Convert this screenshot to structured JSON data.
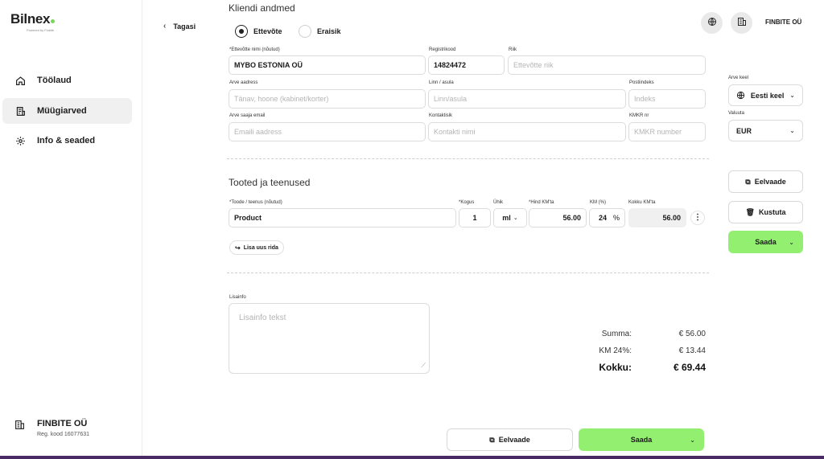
{
  "brand": {
    "logo": "Bilnex",
    "tagline": "Powered by Finbite"
  },
  "sidebar": {
    "items": [
      {
        "label": "Töölaud",
        "icon": "home-icon"
      },
      {
        "label": "Müügiarved",
        "icon": "invoice-icon",
        "active": true
      },
      {
        "label": "Info & seaded",
        "icon": "gear-icon"
      }
    ],
    "company": {
      "name": "FINBITE OÜ",
      "reg": "Reg. kood 16077631",
      "icon": "building-icon"
    }
  },
  "nav": {
    "back_label": "Tagasi"
  },
  "header": {
    "company_name": "FINBITE OÜ",
    "icons": [
      "globe-icon",
      "building-icon"
    ]
  },
  "client": {
    "title": "Kliendi andmed",
    "type_options": [
      "Ettevõte",
      "Eraisik"
    ],
    "type_selected": "Ettevõte",
    "fields": {
      "company_name": {
        "label": "*Ettevõtte nimi (nõutud)",
        "value": "MYBO ESTONIA OÜ"
      },
      "reg_code": {
        "label": "Registrikood",
        "value": "14824472"
      },
      "country": {
        "label": "Riik",
        "placeholder": "Ettevõtte riik"
      },
      "address": {
        "label": "Arve aadress",
        "placeholder": "Tänav, hoone (kabinet/korter)"
      },
      "city": {
        "label": "Linn / asula",
        "placeholder": "Linn/asula"
      },
      "postal": {
        "label": "Postiindeks",
        "placeholder": "Indeks"
      },
      "email": {
        "label": "Arve saaja email",
        "placeholder": "Emaili aadress"
      },
      "contact": {
        "label": "Kontaktisik",
        "placeholder": "Kontakti nimi"
      },
      "kmkr": {
        "label": "KMKR nr",
        "placeholder": "KMKR number"
      }
    }
  },
  "products": {
    "title": "Tooted ja teenused",
    "columns": [
      "*Toode / teenus (nõutud)",
      "*Kogus",
      "Ühik",
      "*Hind KM'ta",
      "KM (%)",
      "Kokku KM'ta"
    ],
    "rows": [
      {
        "name": "Product",
        "qty": "1",
        "unit": "ml",
        "price": "56.00",
        "vat": "24",
        "vat_unit": "%",
        "total": "56.00"
      }
    ],
    "add_row_label": "Lisa uus rida"
  },
  "extra": {
    "label": "Lisainfo",
    "placeholder": "Lisainfo tekst"
  },
  "totals": {
    "sum_label": "Summa:",
    "sum_value": "€ 56.00",
    "vat_label": "KM 24%:",
    "vat_value": "€ 13.44",
    "total_label": "Kokku:",
    "total_value": "€ 69.44"
  },
  "settings": {
    "language_label": "Arve keel",
    "language_value": "Eesti keel",
    "currency_label": "Valuuta",
    "currency_value": "EUR"
  },
  "actions": {
    "preview": "Eelvaade",
    "delete": "Kustuta",
    "send": "Saada",
    "bottom_preview": "Eelvaade",
    "bottom_send": "Saada"
  },
  "colors": {
    "accent_green": "#93ef70",
    "bottom_bar": "#4a2a63"
  }
}
